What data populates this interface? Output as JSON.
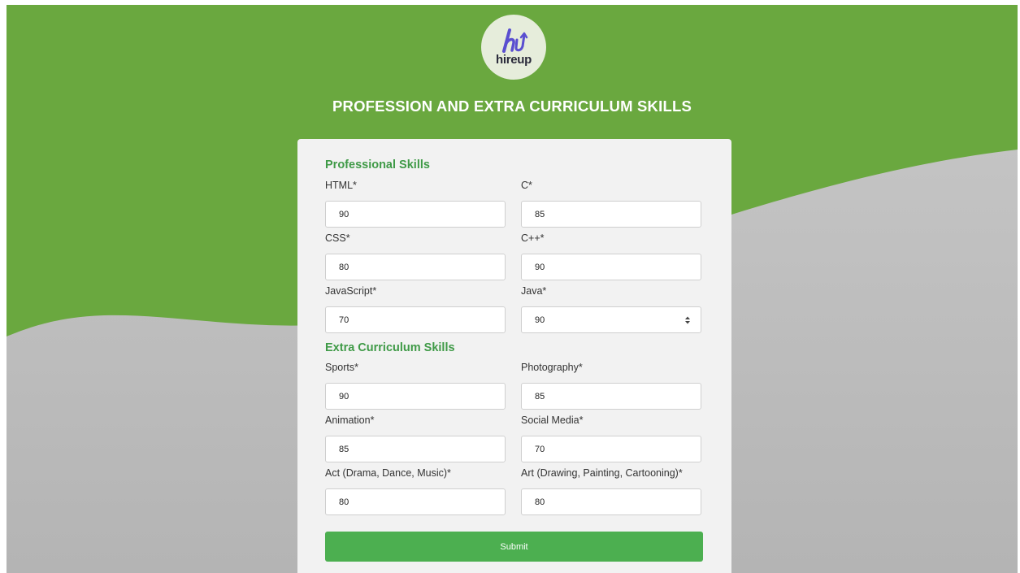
{
  "logo": {
    "text": "hireup",
    "icon": "hireup-logo-icon"
  },
  "page_title": "PROFESSION AND EXTRA CURRICULUM SKILLS",
  "colors": {
    "header_green": "#6aa83f",
    "accent_green": "#3f9a47",
    "button_green": "#4caf50",
    "card_bg": "#f2f2f2",
    "lower_gray": "#c0c0c0"
  },
  "professional": {
    "title": "Professional Skills",
    "fields": [
      {
        "label": "HTML*",
        "value": "90"
      },
      {
        "label": "C*",
        "value": "85"
      },
      {
        "label": "CSS*",
        "value": "80"
      },
      {
        "label": "C++*",
        "value": "90"
      },
      {
        "label": "JavaScript*",
        "value": "70"
      },
      {
        "label": "Java*",
        "value": "90"
      }
    ]
  },
  "extra": {
    "title": "Extra Curriculum Skills",
    "fields": [
      {
        "label": "Sports*",
        "value": "90"
      },
      {
        "label": "Photography*",
        "value": "85"
      },
      {
        "label": "Animation*",
        "value": "85"
      },
      {
        "label": "Social Media*",
        "value": "70"
      },
      {
        "label": "Act (Drama, Dance, Music)*",
        "value": "80"
      },
      {
        "label": "Art (Drawing, Painting, Cartooning)*",
        "value": "80"
      }
    ]
  },
  "submit_label": "Submit"
}
